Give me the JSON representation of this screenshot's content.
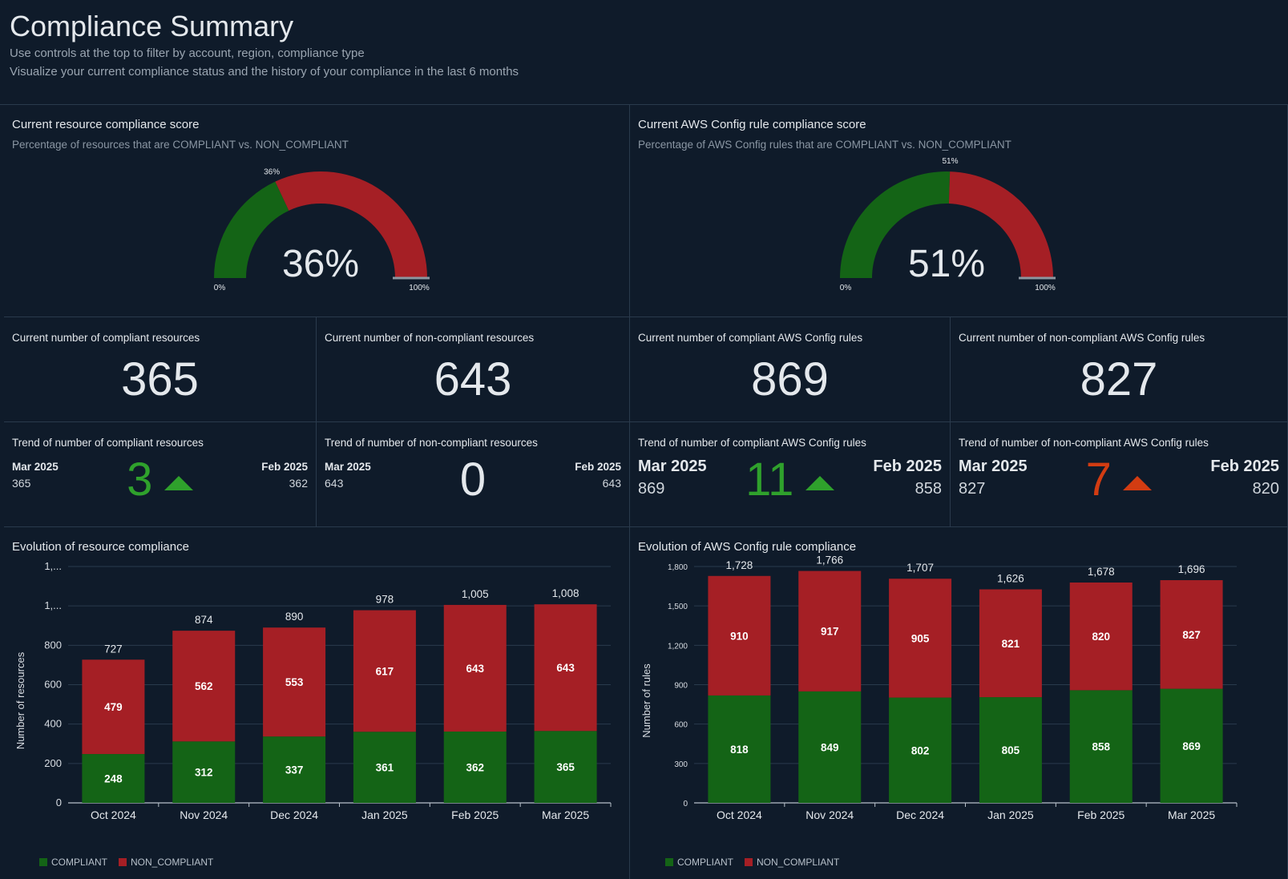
{
  "header": {
    "title": "Compliance Summary",
    "subtitle1": "Use controls at the top to filter by account, region, compliance type",
    "subtitle2": "Visualize your current compliance status and the history of your compliance in the last 6 months"
  },
  "colors": {
    "compliant": "#146416",
    "non_compliant": "#a51f25",
    "up_green": "#2fa12c",
    "up_red": "#d23c12"
  },
  "gauges": [
    {
      "title": "Current resource compliance score",
      "subtitle": "Percentage of resources that are COMPLIANT vs. NON_COMPLIANT",
      "value": 36,
      "value_text": "36%",
      "marker": "36%",
      "min": "0%",
      "max": "100%"
    },
    {
      "title": "Current AWS Config rule compliance score",
      "subtitle": "Percentage of AWS Config rules that are COMPLIANT vs. NON_COMPLIANT",
      "value": 51,
      "value_text": "51%",
      "marker": "51%",
      "min": "0%",
      "max": "100%"
    }
  ],
  "kpis": [
    {
      "label": "Current number of compliant resources",
      "value": "365"
    },
    {
      "label": "Current number of non-compliant resources",
      "value": "643"
    },
    {
      "label": "Current number of compliant AWS Config rules",
      "value": "869"
    },
    {
      "label": "Current number of non-compliant AWS Config rules",
      "value": "827"
    }
  ],
  "trends": [
    {
      "label": "Trend of number of compliant resources",
      "left_period": "Mar 2025",
      "left_value": "365",
      "right_period": "Feb 2025",
      "right_value": "362",
      "delta": "3",
      "direction": "up",
      "color": "green"
    },
    {
      "label": "Trend of number of non-compliant resources",
      "left_period": "Mar 2025",
      "left_value": "643",
      "right_period": "Feb 2025",
      "right_value": "643",
      "delta": "0",
      "direction": "none",
      "color": "neutral"
    },
    {
      "label": "Trend of number of compliant AWS Config rules",
      "left_period": "Mar 2025",
      "left_value": "869",
      "right_period": "Feb 2025",
      "right_value": "858",
      "delta": "11",
      "direction": "up",
      "color": "green"
    },
    {
      "label": "Trend of number of non-compliant AWS Config rules",
      "left_period": "Mar 2025",
      "left_value": "827",
      "right_period": "Feb 2025",
      "right_value": "820",
      "delta": "7",
      "direction": "up",
      "color": "red"
    }
  ],
  "legend": {
    "compliant": "COMPLIANT",
    "non_compliant": "NON_COMPLIANT"
  },
  "chart_data": [
    {
      "type": "bar",
      "stacked": true,
      "title": "Evolution of resource compliance",
      "ylabel": "Number of resources",
      "xlabel": "",
      "ylim": [
        0,
        1200
      ],
      "yticks": [
        0,
        200,
        400,
        600,
        800,
        1000,
        1200
      ],
      "ytick_labels": [
        "0",
        "200",
        "400",
        "600",
        "800",
        "1,...",
        "1,..."
      ],
      "categories": [
        "Oct 2024",
        "Nov 2024",
        "Dec 2024",
        "Jan 2025",
        "Feb 2025",
        "Mar 2025"
      ],
      "series": [
        {
          "name": "COMPLIANT",
          "values": [
            248,
            312,
            337,
            361,
            362,
            365
          ]
        },
        {
          "name": "NON_COMPLIANT",
          "values": [
            479,
            562,
            553,
            617,
            643,
            643
          ]
        }
      ],
      "totals": [
        "727",
        "874",
        "890",
        "978",
        "1,005",
        "1,008"
      ],
      "legend_position": "bottom-left",
      "grid": true
    },
    {
      "type": "bar",
      "stacked": true,
      "title": "Evolution of AWS Config rule compliance",
      "ylabel": "Number of rules",
      "xlabel": "",
      "ylim": [
        0,
        1800
      ],
      "yticks": [
        0,
        300,
        600,
        900,
        1200,
        1500,
        1800
      ],
      "ytick_labels": [
        "0",
        "300",
        "600",
        "900",
        "1,200",
        "1,500",
        "1,800"
      ],
      "categories": [
        "Oct 2024",
        "Nov 2024",
        "Dec 2024",
        "Jan 2025",
        "Feb 2025",
        "Mar 2025"
      ],
      "series": [
        {
          "name": "COMPLIANT",
          "values": [
            818,
            849,
            802,
            805,
            858,
            869
          ]
        },
        {
          "name": "NON_COMPLIANT",
          "values": [
            910,
            917,
            905,
            821,
            820,
            827
          ]
        }
      ],
      "totals": [
        "1,728",
        "1,766",
        "1,707",
        "1,626",
        "1,678",
        "1,696"
      ],
      "legend_position": "bottom-left",
      "grid": true
    }
  ]
}
